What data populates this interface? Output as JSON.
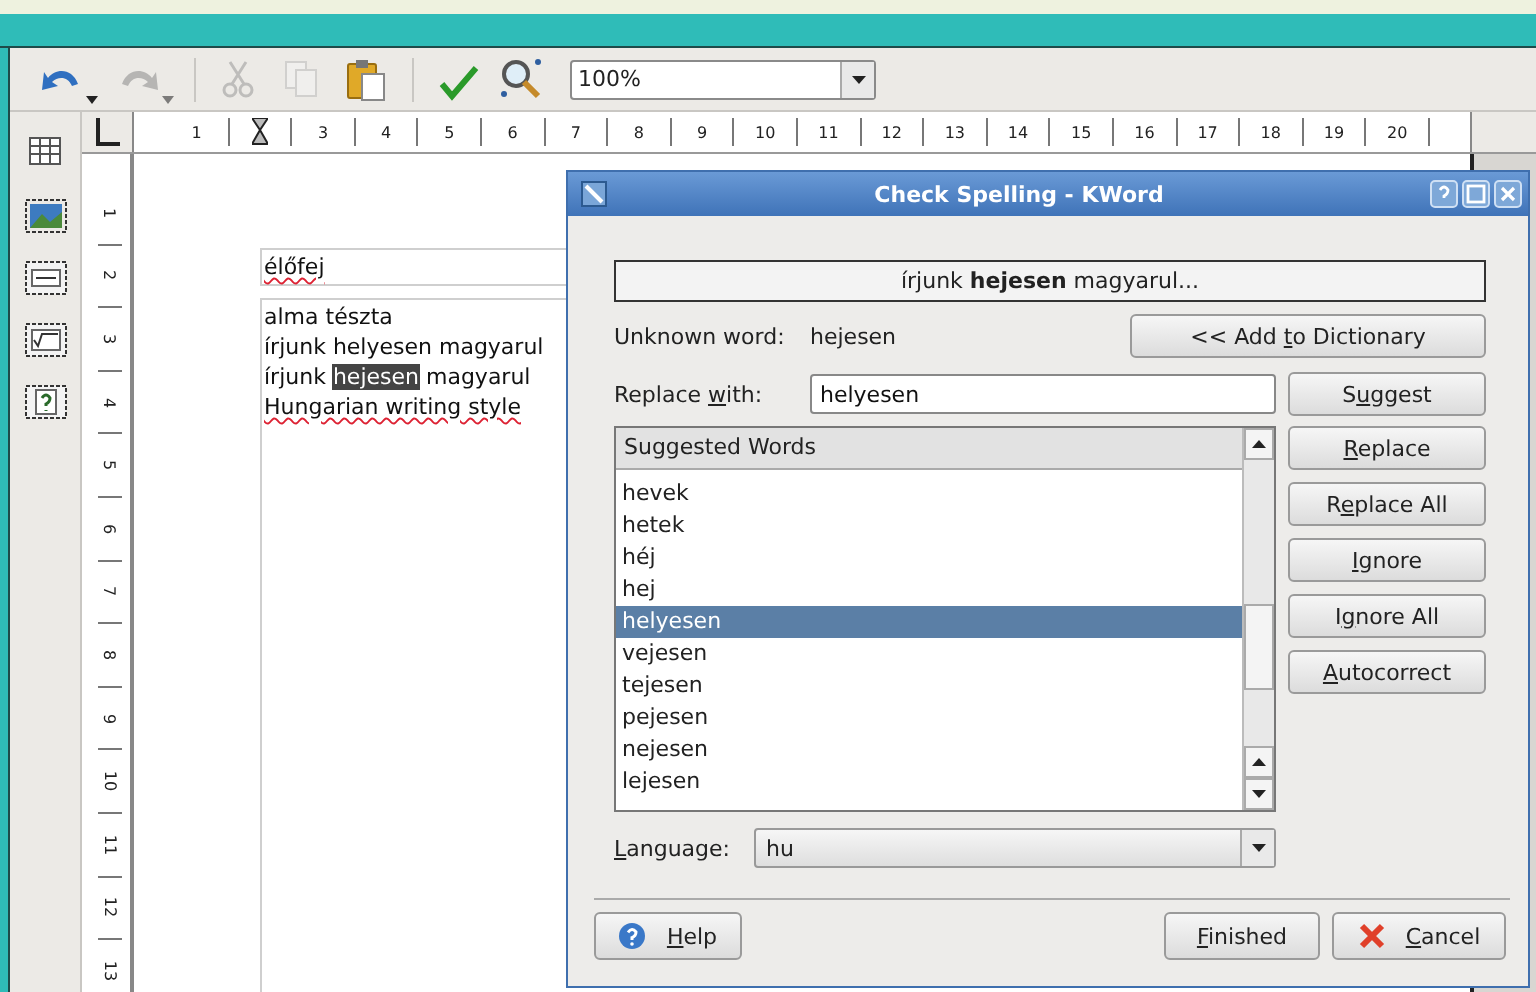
{
  "toolbar": {
    "tools": [
      {
        "kind": "undo",
        "disabled": false,
        "dropdown": true
      },
      {
        "kind": "redo",
        "disabled": true,
        "dropdown": true
      },
      {
        "kind": "separator"
      },
      {
        "kind": "cut",
        "disabled": true,
        "dropdown": false
      },
      {
        "kind": "copy",
        "disabled": true,
        "dropdown": false
      },
      {
        "kind": "paste",
        "disabled": false,
        "dropdown": false
      },
      {
        "kind": "separator"
      },
      {
        "kind": "spellcheck",
        "disabled": false,
        "dropdown": false
      },
      {
        "kind": "find",
        "disabled": false,
        "dropdown": false
      }
    ],
    "zoom": {
      "value": "100%"
    }
  },
  "side_tools": [
    {
      "kind": "table"
    },
    {
      "kind": "picture"
    },
    {
      "kind": "text-frame"
    },
    {
      "kind": "formula"
    },
    {
      "kind": "variable"
    }
  ],
  "ruler": {
    "h_marks": [
      {
        "kind": "number",
        "label": "1"
      },
      {
        "kind": "indent-marker"
      },
      {
        "kind": "number",
        "label": "3"
      },
      {
        "kind": "number",
        "label": "4"
      },
      {
        "kind": "number",
        "label": "5"
      },
      {
        "kind": "number",
        "label": "6"
      },
      {
        "kind": "number",
        "label": "7"
      },
      {
        "kind": "number",
        "label": "8"
      },
      {
        "kind": "number",
        "label": "9"
      },
      {
        "kind": "number",
        "label": "10"
      },
      {
        "kind": "number",
        "label": "11"
      },
      {
        "kind": "number",
        "label": "12"
      },
      {
        "kind": "number",
        "label": "13"
      },
      {
        "kind": "number",
        "label": "14"
      },
      {
        "kind": "number",
        "label": "15"
      },
      {
        "kind": "number",
        "label": "16"
      },
      {
        "kind": "number",
        "label": "17"
      },
      {
        "kind": "number",
        "label": "18"
      },
      {
        "kind": "number",
        "label": "19"
      },
      {
        "kind": "number",
        "label": "20"
      }
    ],
    "v_labels": [
      "1",
      "2",
      "3",
      "4",
      "5",
      "6",
      "7",
      "8",
      "9",
      "10",
      "11",
      "12",
      "13"
    ]
  },
  "document": {
    "header": {
      "text": "élőfej",
      "misspelled": true
    },
    "lines": [
      {
        "segments": [
          {
            "text": "alma tészta",
            "misspelled": false,
            "selected": false
          }
        ]
      },
      {
        "segments": [
          {
            "text": "írjunk helyesen magyarul",
            "misspelled": false,
            "selected": false
          }
        ]
      },
      {
        "segments": [
          {
            "text": "írjunk ",
            "misspelled": false,
            "selected": false
          },
          {
            "text": "hejesen",
            "misspelled": false,
            "selected": true
          },
          {
            "text": " magyarul",
            "misspelled": false,
            "selected": false
          }
        ]
      },
      {
        "segments": [
          {
            "text": "Hungarian writing style",
            "misspelled": true,
            "selected": false
          }
        ]
      }
    ]
  },
  "dialog": {
    "title": "Check Spelling - KWord",
    "context": "írjunk **hejesen** magyarul...",
    "unknown_label": "Unknown word:",
    "unknown_word": "hejesen",
    "add_button": {
      "before": "<< Add ",
      "key": "t",
      "after": "o Dictionary"
    },
    "replace_label": {
      "before": "Replace ",
      "key": "w",
      "after": "ith:"
    },
    "replace_value": "helyesen",
    "suggest_button": {
      "before": "S",
      "key": "u",
      "after": "ggest"
    },
    "list_header": "Suggested Words",
    "suggestions": [
      {
        "text": "hevek",
        "selected": false
      },
      {
        "text": "hetek",
        "selected": false
      },
      {
        "text": "héj",
        "selected": false
      },
      {
        "text": "hej",
        "selected": false
      },
      {
        "text": "helyesen",
        "selected": true
      },
      {
        "text": "vejesen",
        "selected": false
      },
      {
        "text": "tejesen",
        "selected": false
      },
      {
        "text": "pejesen",
        "selected": false
      },
      {
        "text": "nejesen",
        "selected": false
      },
      {
        "text": "lejesen",
        "selected": false
      }
    ],
    "side_buttons": [
      {
        "key": "R",
        "after": "eplace"
      },
      {
        "before": "R",
        "key": "e",
        "after": "place All"
      },
      {
        "key": "I",
        "after": "gnore"
      },
      {
        "before": "I",
        "key": "g",
        "after": "nore All"
      },
      {
        "key": "A",
        "after": "utocorrect"
      }
    ],
    "language": {
      "label": {
        "key": "L",
        "after": "anguage:"
      },
      "value": "hu"
    },
    "help_button": {
      "key": "H",
      "after": "elp"
    },
    "finished_button": {
      "key": "F",
      "after": "inished"
    },
    "cancel_button": {
      "key": "C",
      "after": "ancel"
    }
  }
}
